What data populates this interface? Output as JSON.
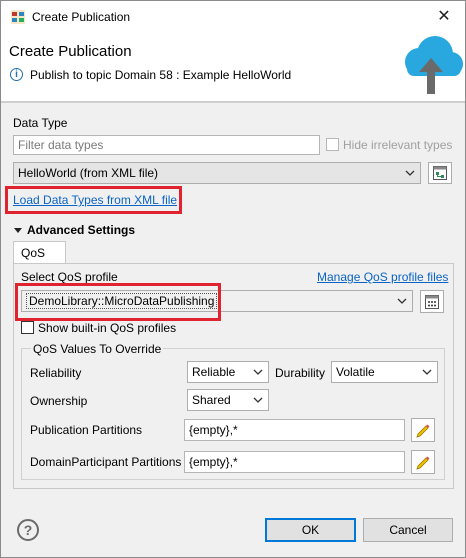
{
  "window": {
    "title": "Create Publication",
    "close_glyph": "✕"
  },
  "header": {
    "title": "Create Publication",
    "message": "Publish to topic Domain 58 : Example HelloWorld",
    "info_icon": "i",
    "banner_icon": "cloud-upload-icon"
  },
  "data_type": {
    "label": "Data Type",
    "filter_placeholder": "Filter data types",
    "hide_irrelevant_label": "Hide irrelevant types",
    "hide_irrelevant_checked": false,
    "selected": "HelloWorld (from XML file)",
    "load_link": "Load Data Types from XML file"
  },
  "advanced": {
    "label": "Advanced Settings",
    "expanded": true,
    "tabs": [
      {
        "label": "QoS"
      }
    ],
    "select_profile_label": "Select QoS profile",
    "manage_link": "Manage QoS profile files",
    "selected_profile": "DemoLibrary::MicroDataPublishing",
    "show_builtin_label": "Show built-in QoS profiles",
    "show_builtin_checked": false,
    "override_group": {
      "title": "QoS Values To Override",
      "reliability_label": "Reliability",
      "reliability_value": "Reliable",
      "durability_label": "Durability",
      "durability_value": "Volatile",
      "ownership_label": "Ownership",
      "ownership_value": "Shared",
      "pub_partitions_label": "Publication Partitions",
      "pub_partitions_value": "{empty},*",
      "dp_partitions_label": "DomainParticipant Partitions",
      "dp_partitions_value": "{empty},*"
    }
  },
  "footer": {
    "help_glyph": "?",
    "ok_label": "OK",
    "cancel_label": "Cancel"
  },
  "colors": {
    "highlight_box": "#e0242f",
    "link": "#0b63c5",
    "cloud": "#29a8e0",
    "default_button_border": "#0078d7"
  }
}
